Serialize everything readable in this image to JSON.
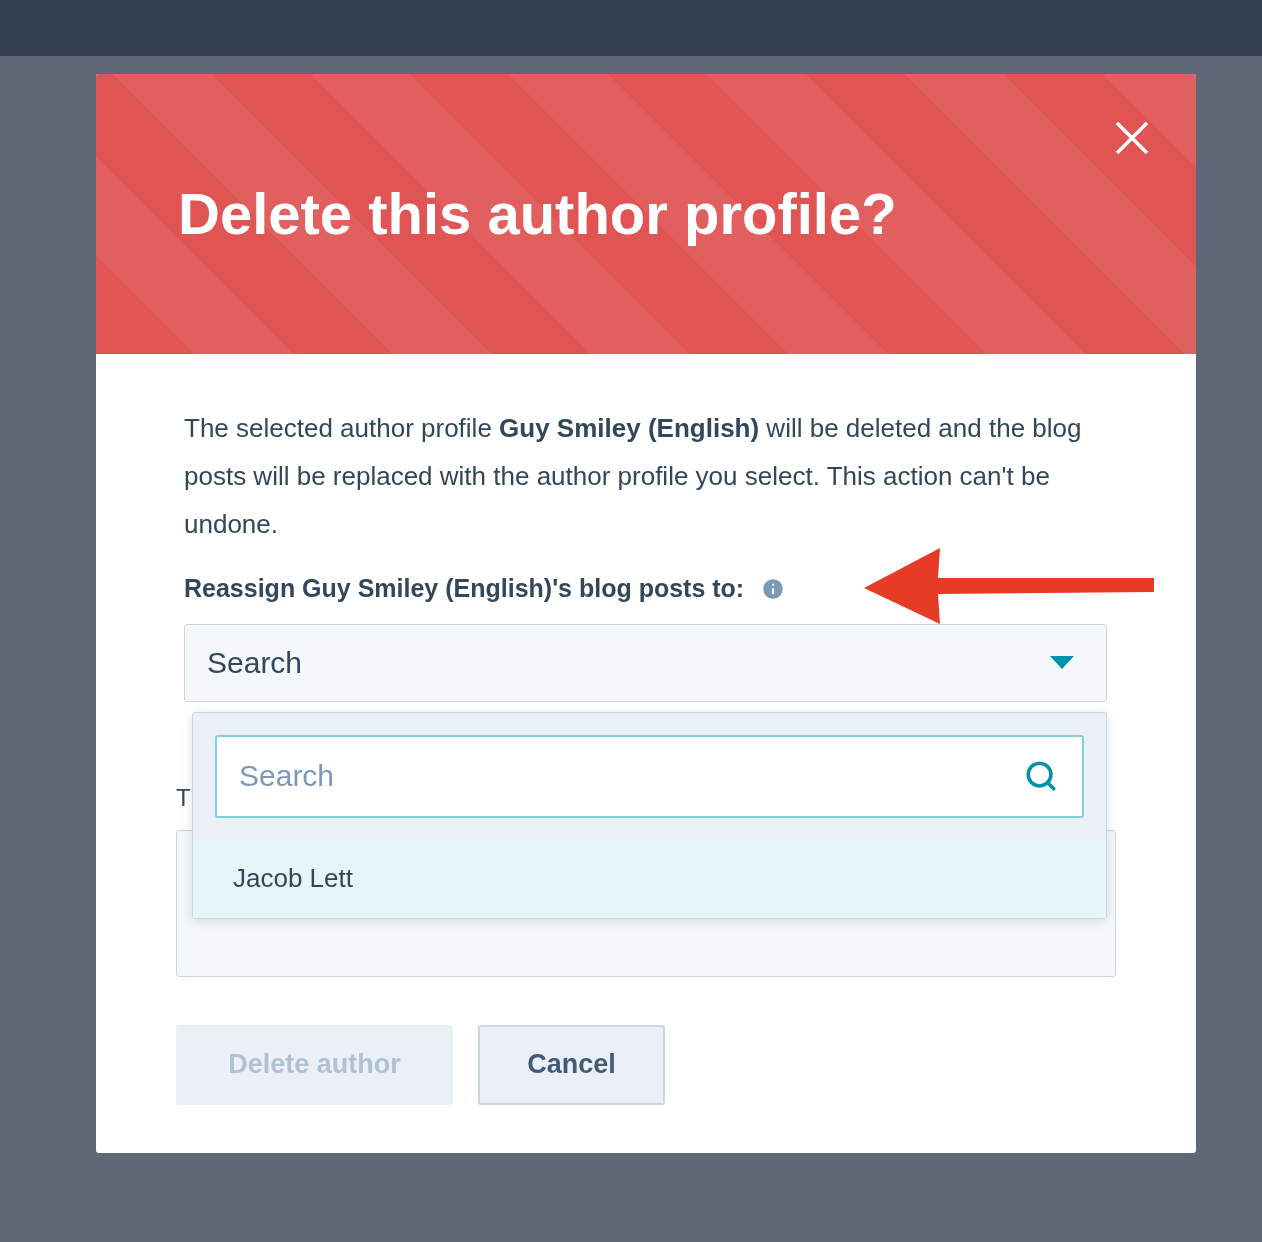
{
  "dialog": {
    "title": "Delete this author profile?",
    "message": "The selected author profile **Guy Smiley (English)** will be deleted and the blog posts will be replaced with the author profile you select. This action can't be undone.",
    "reassign_label": "Reassign Guy Smiley (English)'s blog posts to:",
    "select": {
      "value": "Search",
      "expanded": true
    },
    "dropdown": {
      "search": {
        "placeholder": "Search"
      },
      "options": [
        {
          "label": "Jacob Lett",
          "selected": true
        }
      ]
    },
    "confirm_label": "T",
    "buttons": [
      {
        "label": "Delete author",
        "kind": "primary",
        "disabled": true
      },
      {
        "label": "Cancel",
        "kind": "secondary",
        "disabled": false
      }
    ]
  }
}
